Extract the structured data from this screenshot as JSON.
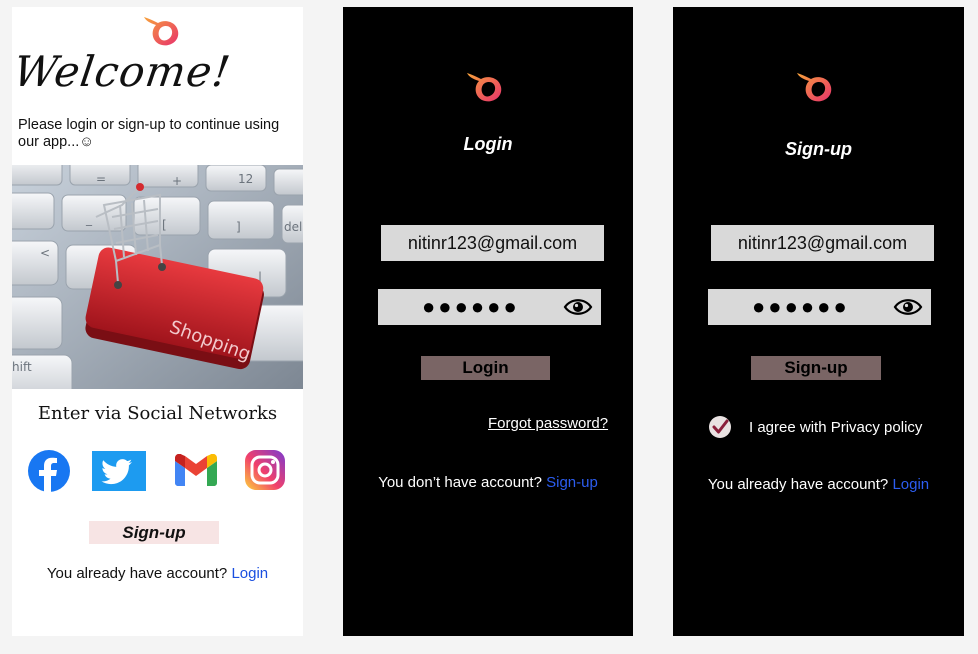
{
  "welcome_screen": {
    "heading": "Welcome!",
    "intro": "Please login or sign-up to continue using our app...☺",
    "hero_image_label": "Shopping",
    "social_title": "Enter via Social Networks",
    "social": [
      "facebook-icon",
      "twitter-icon",
      "gmail-icon",
      "instagram-icon"
    ],
    "signup_button": "Sign-up",
    "account_prompt": "You already have account?",
    "account_link": "Login"
  },
  "login_screen": {
    "title": "Login",
    "email": "nitinr123@gmail.com",
    "password_mask": "●●●●●●",
    "button": "Login",
    "forgot": "Forgot password?",
    "account_prompt": "You don’t have account?",
    "account_link": "Sign-up"
  },
  "signup_screen": {
    "title": "Sign-up",
    "email": "nitinr123@gmail.com",
    "password_mask": "●●●●●●",
    "button": "Sign-up",
    "agree": "I agree with Privacy policy",
    "account_prompt": "You already have account?",
    "account_link": "Login"
  },
  "colors": {
    "dark_bg": "#000000",
    "field_bg": "#d9d9d9",
    "dark_button": "#7a6565",
    "light_button": "#f7e4e4",
    "link": "#1a4fe0",
    "checkmark": "#8a1f3b"
  }
}
